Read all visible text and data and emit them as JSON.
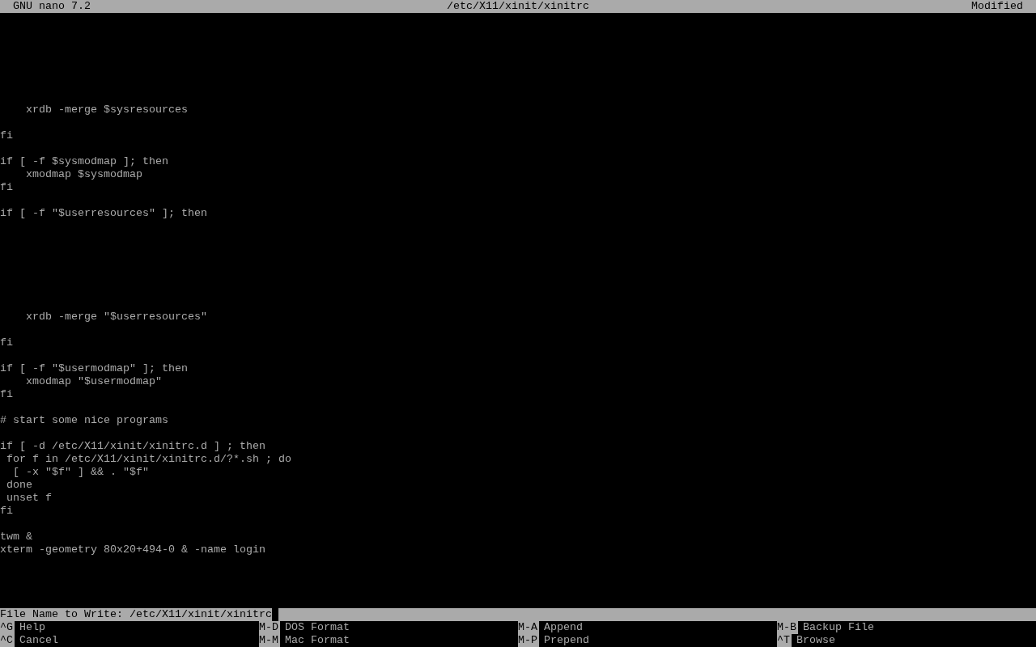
{
  "title_bar": {
    "app": "GNU nano 7.2",
    "file": "/etc/X11/xinit/xinitrc",
    "state": "Modified"
  },
  "lines": [
    {
      "kind": "blank"
    },
    {
      "kind": "blank"
    },
    {
      "kind": "blank"
    },
    {
      "kind": "blank"
    },
    {
      "kind": "blank"
    },
    {
      "kind": "blank"
    },
    {
      "kind": "blank"
    },
    {
      "kind": "text",
      "text": "    xrdb -merge $sysresources"
    },
    {
      "kind": "blank"
    },
    {
      "kind": "text",
      "text": "fi"
    },
    {
      "kind": "blank"
    },
    {
      "kind": "text",
      "text": "if [ -f $sysmodmap ]; then"
    },
    {
      "kind": "text",
      "text": "    xmodmap $sysmodmap"
    },
    {
      "kind": "text",
      "text": "fi"
    },
    {
      "kind": "blank"
    },
    {
      "kind": "text",
      "text": "if [ -f \"$userresources\" ]; then"
    },
    {
      "kind": "blank"
    },
    {
      "kind": "blank"
    },
    {
      "kind": "blank"
    },
    {
      "kind": "blank"
    },
    {
      "kind": "blank"
    },
    {
      "kind": "blank"
    },
    {
      "kind": "blank"
    },
    {
      "kind": "text",
      "text": "    xrdb -merge \"$userresources\""
    },
    {
      "kind": "blank"
    },
    {
      "kind": "text",
      "text": "fi"
    },
    {
      "kind": "blank"
    },
    {
      "kind": "text",
      "text": "if [ -f \"$usermodmap\" ]; then"
    },
    {
      "kind": "text",
      "text": "    xmodmap \"$usermodmap\""
    },
    {
      "kind": "text",
      "text": "fi"
    },
    {
      "kind": "blank"
    },
    {
      "kind": "text",
      "text": "# start some nice programs"
    },
    {
      "kind": "blank"
    },
    {
      "kind": "text",
      "text": "if [ -d /etc/X11/xinit/xinitrc.d ] ; then"
    },
    {
      "kind": "text",
      "text": " for f in /etc/X11/xinit/xinitrc.d/?*.sh ; do"
    },
    {
      "kind": "text",
      "text": "  [ -x \"$f\" ] && . \"$f\""
    },
    {
      "kind": "text",
      "text": " done"
    },
    {
      "kind": "text",
      "text": " unset f"
    },
    {
      "kind": "text",
      "text": "fi"
    },
    {
      "kind": "blank"
    },
    {
      "kind": "text",
      "text": "twm &"
    },
    {
      "kind": "text",
      "text": "xterm -geometry 80x20+494-0 & -name login"
    }
  ],
  "prompt": {
    "label": "File Name to Write:",
    "value": "/etc/X11/xinit/xinitrc"
  },
  "shortcuts": [
    [
      {
        "key": "^G",
        "label": "Help"
      },
      {
        "key": "M-D",
        "label": "DOS Format"
      },
      {
        "key": "M-A",
        "label": "Append"
      },
      {
        "key": "M-B",
        "label": "Backup File"
      }
    ],
    [
      {
        "key": "^C",
        "label": "Cancel"
      },
      {
        "key": "M-M",
        "label": "Mac Format"
      },
      {
        "key": "M-P",
        "label": "Prepend"
      },
      {
        "key": "^T",
        "label": "Browse"
      }
    ]
  ]
}
